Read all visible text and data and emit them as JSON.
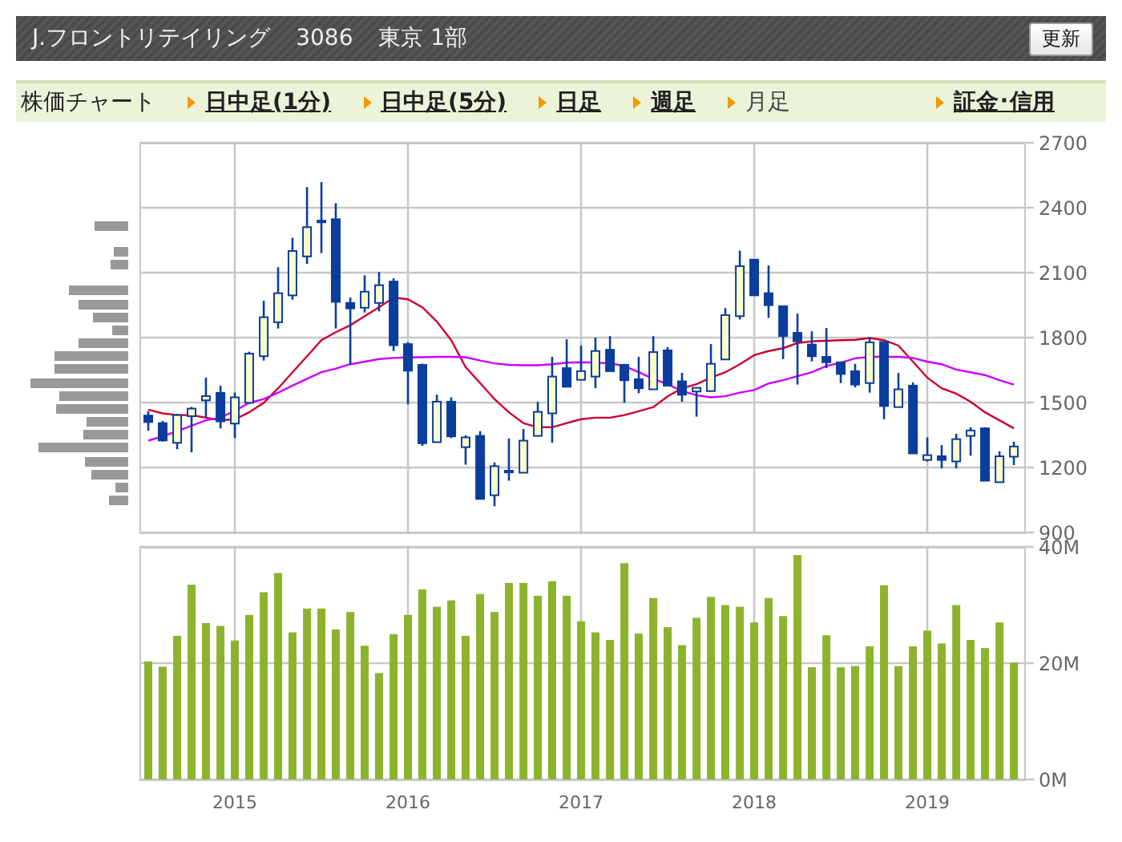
{
  "header": {
    "title": "J.フロントリテイリング",
    "code": "3086",
    "market": "東京 1部",
    "refresh_button": "更新"
  },
  "nav": {
    "label": "株価チャート",
    "tabs": [
      {
        "label": "日中足(1分)",
        "selected": false
      },
      {
        "label": "日中足(5分)",
        "selected": false
      },
      {
        "label": "日足",
        "selected": false
      },
      {
        "label": "週足",
        "selected": false
      },
      {
        "label": "月足",
        "selected": true
      }
    ],
    "margin_link": "証金･信用"
  },
  "price_chart": {
    "chart_data": {
      "type": "candlestick",
      "grid": true,
      "x": [
        2014.5,
        2014.583,
        2014.667,
        2014.75,
        2014.833,
        2014.917,
        2015,
        2015.083,
        2015.167,
        2015.25,
        2015.333,
        2015.417,
        2015.5,
        2015.583,
        2015.667,
        2015.75,
        2015.833,
        2015.917,
        2016,
        2016.083,
        2016.167,
        2016.25,
        2016.333,
        2016.417,
        2016.5,
        2016.583,
        2016.667,
        2016.75,
        2016.833,
        2016.917,
        2017,
        2017.083,
        2017.167,
        2017.25,
        2017.333,
        2017.417,
        2017.5,
        2017.583,
        2017.667,
        2017.75,
        2017.833,
        2017.917,
        2018,
        2018.083,
        2018.167,
        2018.25,
        2018.333,
        2018.417,
        2018.5,
        2018.583,
        2018.667,
        2018.75,
        2018.833,
        2018.917,
        2019,
        2019.083,
        2019.167,
        2019.25,
        2019.333,
        2019.417,
        2019.5
      ],
      "ohlc": [
        [
          1440,
          1460,
          1370,
          1410
        ],
        [
          1405,
          1415,
          1320,
          1325
        ],
        [
          1314,
          1447,
          1285,
          1442
        ],
        [
          1437,
          1480,
          1270,
          1472
        ],
        [
          1510,
          1615,
          1430,
          1530
        ],
        [
          1545,
          1578,
          1380,
          1413
        ],
        [
          1403,
          1546,
          1336,
          1524
        ],
        [
          1499,
          1735,
          1495,
          1726
        ],
        [
          1714,
          1970,
          1694,
          1894
        ],
        [
          1871,
          2125,
          1842,
          2005
        ],
        [
          1995,
          2261,
          1975,
          2200
        ],
        [
          2175,
          2495,
          2140,
          2310
        ],
        [
          2335,
          2518,
          2190,
          2340
        ],
        [
          2347,
          2421,
          1842,
          1965
        ],
        [
          1960,
          1985,
          1677,
          1935
        ],
        [
          1938,
          2088,
          1916,
          2012
        ],
        [
          1960,
          2103,
          1921,
          2042
        ],
        [
          2059,
          2074,
          1738,
          1765
        ],
        [
          1770,
          1778,
          1492,
          1647
        ],
        [
          1674,
          1680,
          1300,
          1312
        ],
        [
          1317,
          1536,
          1315,
          1504
        ],
        [
          1504,
          1524,
          1336,
          1344
        ],
        [
          1294,
          1349,
          1213,
          1339
        ],
        [
          1346,
          1368,
          1055,
          1055
        ],
        [
          1072,
          1223,
          1021,
          1206
        ],
        [
          1185,
          1334,
          1139,
          1185
        ],
        [
          1176,
          1378,
          1176,
          1324
        ],
        [
          1346,
          1504,
          1346,
          1457
        ],
        [
          1450,
          1711,
          1314,
          1620
        ],
        [
          1659,
          1792,
          1573,
          1573
        ],
        [
          1605,
          1763,
          1605,
          1645
        ],
        [
          1620,
          1800,
          1566,
          1738
        ],
        [
          1744,
          1807,
          1645,
          1645
        ],
        [
          1674,
          1679,
          1499,
          1603
        ],
        [
          1608,
          1711,
          1543,
          1566
        ],
        [
          1561,
          1807,
          1561,
          1733
        ],
        [
          1741,
          1756,
          1578,
          1578
        ],
        [
          1598,
          1637,
          1504,
          1536
        ],
        [
          1551,
          1568,
          1435,
          1568
        ],
        [
          1553,
          1770,
          1553,
          1679
        ],
        [
          1699,
          1936,
          1699,
          1904
        ],
        [
          1899,
          2202,
          1884,
          2130
        ],
        [
          2160,
          2160,
          1995,
          1995
        ],
        [
          2005,
          2133,
          1891,
          1950
        ],
        [
          1945,
          1945,
          1701,
          1807
        ],
        [
          1822,
          1911,
          1583,
          1783
        ],
        [
          1768,
          1829,
          1690,
          1714
        ],
        [
          1711,
          1844,
          1659,
          1686
        ],
        [
          1686,
          1686,
          1590,
          1632
        ],
        [
          1645,
          1679,
          1570,
          1583
        ],
        [
          1590,
          1802,
          1546,
          1778
        ],
        [
          1780,
          1780,
          1423,
          1484
        ],
        [
          1479,
          1637,
          1479,
          1561
        ],
        [
          1578,
          1593,
          1265,
          1265
        ],
        [
          1235,
          1339,
          1228,
          1257
        ],
        [
          1252,
          1304,
          1196,
          1235
        ],
        [
          1228,
          1356,
          1196,
          1331
        ],
        [
          1346,
          1386,
          1255,
          1371
        ],
        [
          1381,
          1386,
          1139,
          1139
        ],
        [
          1132,
          1275,
          1132,
          1252
        ],
        [
          1250,
          1319,
          1211,
          1297
        ]
      ],
      "xlim": [
        2014.449,
        2019.569
      ],
      "ylim": [
        900,
        2700
      ],
      "yticks": [
        900,
        1200,
        1500,
        1800,
        2100,
        2400,
        2700
      ],
      "series": [
        {
          "type": "line",
          "color": "#cc0033",
          "values": [
            1467,
            1450,
            1442,
            1442,
            1430,
            1418,
            1423,
            1455,
            1499,
            1566,
            1640,
            1714,
            1788,
            1825,
            1857,
            1899,
            1940,
            1985,
            1977,
            1940,
            1874,
            1788,
            1664,
            1590,
            1516,
            1455,
            1405,
            1386,
            1386,
            1405,
            1423,
            1430,
            1430,
            1442,
            1460,
            1479,
            1529,
            1566,
            1585,
            1615,
            1640,
            1677,
            1719,
            1738,
            1751,
            1775,
            1783,
            1785,
            1788,
            1790,
            1798,
            1788,
            1763,
            1689,
            1615,
            1566,
            1541,
            1504,
            1455,
            1418,
            1381
          ]
        },
        {
          "type": "line",
          "color": "#cc00ff",
          "values": [
            1324,
            1344,
            1368,
            1393,
            1418,
            1430,
            1462,
            1499,
            1516,
            1546,
            1578,
            1610,
            1640,
            1657,
            1677,
            1689,
            1701,
            1706,
            1709,
            1709,
            1711,
            1711,
            1709,
            1694,
            1681,
            1674,
            1672,
            1672,
            1677,
            1684,
            1686,
            1684,
            1681,
            1669,
            1640,
            1610,
            1585,
            1553,
            1534,
            1524,
            1529,
            1546,
            1558,
            1588,
            1603,
            1622,
            1640,
            1669,
            1684,
            1704,
            1711,
            1711,
            1711,
            1706,
            1689,
            1677,
            1652,
            1640,
            1627,
            1603,
            1583
          ]
        }
      ]
    }
  },
  "volume_chart": {
    "chart_data": {
      "type": "bar",
      "grid": true,
      "x": [
        2014.5,
        2014.583,
        2014.667,
        2014.75,
        2014.833,
        2014.917,
        2015,
        2015.083,
        2015.167,
        2015.25,
        2015.333,
        2015.417,
        2015.5,
        2015.583,
        2015.667,
        2015.75,
        2015.833,
        2015.917,
        2016,
        2016.083,
        2016.167,
        2016.25,
        2016.333,
        2016.417,
        2016.5,
        2016.583,
        2016.667,
        2016.75,
        2016.833,
        2016.917,
        2017,
        2017.083,
        2017.167,
        2017.25,
        2017.333,
        2017.417,
        2017.5,
        2017.583,
        2017.667,
        2017.75,
        2017.833,
        2017.917,
        2018,
        2018.083,
        2018.167,
        2018.25,
        2018.333,
        2018.417,
        2018.5,
        2018.583,
        2018.667,
        2018.75,
        2018.833,
        2018.917,
        2019,
        2019.083,
        2019.167,
        2019.25,
        2019.333,
        2019.417,
        2019.5
      ],
      "xlim": [
        2014.449,
        2019.569
      ],
      "ylim": [
        0,
        40
      ],
      "yticks": [
        {
          "value": 0,
          "label": "0M"
        },
        {
          "value": 20,
          "label": "20M"
        },
        {
          "value": 40,
          "label": "40M"
        }
      ],
      "xticks": [
        {
          "value": 2015,
          "label": "2015"
        },
        {
          "value": 2016,
          "label": "2016"
        },
        {
          "value": 2017,
          "label": "2017"
        },
        {
          "value": 2018,
          "label": "2018"
        },
        {
          "value": 2019,
          "label": "2019"
        }
      ],
      "series": [
        {
          "color": "#8db32e",
          "values": [
            20.3,
            19.4,
            24.7,
            33.5,
            26.9,
            26.4,
            23.9,
            28.3,
            32.2,
            35.5,
            25.3,
            29.4,
            29.4,
            25.8,
            28.8,
            23.0,
            18.3,
            25.0,
            28.3,
            32.7,
            29.7,
            30.8,
            24.7,
            31.9,
            28.8,
            33.8,
            33.8,
            31.6,
            34.1,
            31.6,
            27.2,
            25.3,
            24.0,
            37.2,
            25.1,
            31.2,
            26.2,
            23.1,
            27.8,
            31.4,
            30.0,
            29.7,
            27.0,
            31.2,
            28.1,
            38.6,
            19.3,
            24.8,
            19.3,
            19.5,
            22.9,
            33.4,
            19.5,
            22.9,
            25.6,
            23.4,
            30.0,
            24.0,
            22.6,
            27.0,
            20.1
          ]
        }
      ]
    }
  }
}
